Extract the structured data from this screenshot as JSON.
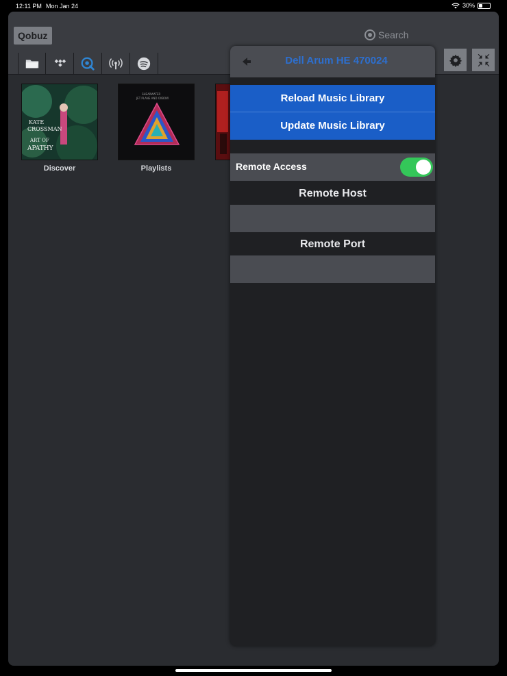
{
  "status_bar": {
    "time": "12:11 PM",
    "date": "Mon Jan 24",
    "battery": "30%"
  },
  "header": {
    "source_label": "Qobuz",
    "search_placeholder": "Search",
    "tabs": [
      {
        "icon": "folder-icon"
      },
      {
        "icon": "tidal-icon"
      },
      {
        "icon": "qobuz-icon",
        "active": true
      },
      {
        "icon": "radio-broadcast-icon"
      },
      {
        "icon": "spotify-icon"
      }
    ],
    "tools": [
      {
        "icon": "gear-icon"
      },
      {
        "icon": "collapse-icon"
      }
    ]
  },
  "library": {
    "tiles": [
      {
        "label": "Discover",
        "art_text": "KATE CROSSMAN ART OF APATHY"
      },
      {
        "label": "Playlists",
        "art_text": "SHEARWATER JET PLANE AND OXBOW"
      },
      {
        "label": ""
      }
    ]
  },
  "settings_panel": {
    "title": "Dell Arum HE 470024",
    "reload_label": "Reload Music Library",
    "update_label": "Update Music Library",
    "remote_access_label": "Remote Access",
    "remote_access_on": true,
    "remote_host_label": "Remote Host",
    "remote_host_value": "",
    "remote_port_label": "Remote Port",
    "remote_port_value": ""
  },
  "colors": {
    "accent_blue": "#1a5ec7",
    "toggle_green": "#34c759",
    "active_tab": "#2f86d4"
  }
}
